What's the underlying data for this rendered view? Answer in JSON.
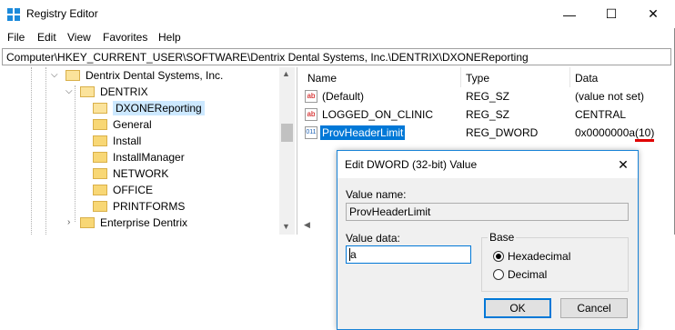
{
  "window": {
    "title": "Registry Editor",
    "controls": {
      "minimize": "—",
      "maximize": "☐",
      "close": "✕"
    }
  },
  "menu": [
    "File",
    "Edit",
    "View",
    "Favorites",
    "Help"
  ],
  "address": "Computer\\HKEY_CURRENT_USER\\SOFTWARE\\Dentrix Dental Systems, Inc.\\DENTRIX\\DXONEReporting",
  "tree": {
    "items": [
      {
        "label": "Dentrix Dental Systems, Inc.",
        "expanded": true
      },
      {
        "label": "DENTRIX",
        "expanded": true
      },
      {
        "label": "DXONEReporting",
        "selected": true
      },
      {
        "label": "General"
      },
      {
        "label": "Install"
      },
      {
        "label": "InstallManager"
      },
      {
        "label": "NETWORK"
      },
      {
        "label": "OFFICE"
      },
      {
        "label": "PRINTFORMS"
      },
      {
        "label": "Enterprise Dentrix",
        "expanded": false
      }
    ]
  },
  "values": {
    "columns": [
      "Name",
      "Type",
      "Data"
    ],
    "rows": [
      {
        "icon": "string-value-icon",
        "name": "(Default)",
        "type": "REG_SZ",
        "data": "(value not set)"
      },
      {
        "icon": "string-value-icon",
        "name": "LOGGED_ON_CLINIC",
        "type": "REG_SZ",
        "data": "CENTRAL"
      },
      {
        "icon": "dword-value-icon",
        "name": "ProvHeaderLimit",
        "type": "REG_DWORD",
        "data": "0x0000000a",
        "data_suffix": "(10)",
        "selected": true
      }
    ]
  },
  "dialog": {
    "title": "Edit DWORD (32-bit) Value",
    "value_name_label": "Value name:",
    "value_name": "ProvHeaderLimit",
    "value_data_label": "Value data:",
    "value_data": "a",
    "base_label": "Base",
    "hex_label": "Hexadecimal",
    "dec_label": "Decimal",
    "base_selected": "Hexadecimal",
    "ok_label": "OK",
    "cancel_label": "Cancel"
  },
  "colors": {
    "selection_blue": "#0078d7",
    "tree_selection": "#cce8ff",
    "annotation_underline": "#e00000"
  }
}
